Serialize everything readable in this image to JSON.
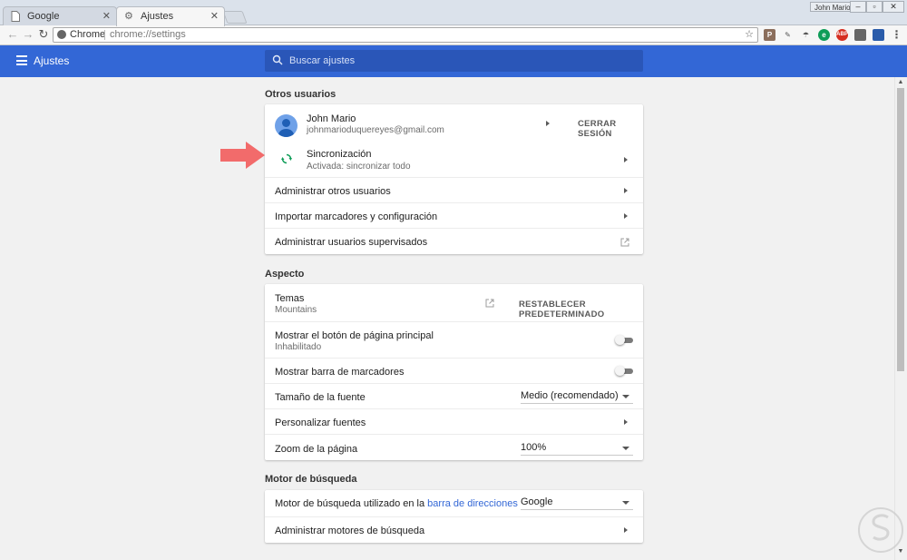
{
  "browser": {
    "tabs": [
      {
        "label": "Google",
        "icon": "page-icon"
      },
      {
        "label": "Ajustes",
        "icon": "gear-icon"
      }
    ],
    "window_user": "John Mario",
    "omnibox": {
      "origin": "Chrome",
      "url": "chrome://settings"
    }
  },
  "header": {
    "title": "Ajustes",
    "search_placeholder": "Buscar ajustes",
    "color": "#3367d6"
  },
  "sections": {
    "otros_usuarios": {
      "title": "Otros usuarios",
      "user_name": "John Mario",
      "user_email": "johnmarioduquereyes@gmail.com",
      "signout_label": "CERRAR SESIÓN",
      "sync_label": "Sincronización",
      "sync_status": "Activada: sincronizar todo",
      "manage_users": "Administrar otros usuarios",
      "import": "Importar marcadores y configuración",
      "supervised": "Administrar usuarios supervisados"
    },
    "aspecto": {
      "title": "Aspecto",
      "themes_label": "Temas",
      "themes_value": "Mountains",
      "reset_label": "RESTABLECER PREDETERMINADO",
      "home_button_label": "Mostrar el botón de página principal",
      "home_button_status": "Inhabilitado",
      "bookmarks_bar_label": "Mostrar barra de marcadores",
      "font_size_label": "Tamaño de la fuente",
      "font_size_value": "Medio (recomendado)",
      "custom_fonts_label": "Personalizar fuentes",
      "zoom_label": "Zoom de la página",
      "zoom_value": "100%"
    },
    "motor": {
      "title": "Motor de búsqueda",
      "engine_label_prefix": "Motor de búsqueda utilizado en la ",
      "engine_label_link": "barra de direcciones",
      "engine_value": "Google",
      "manage_engines": "Administrar motores de búsqueda"
    }
  },
  "colors": {
    "accent": "#3367d6",
    "annotation_arrow": "#f26b6b",
    "sync_icon": "#0f9d58"
  }
}
